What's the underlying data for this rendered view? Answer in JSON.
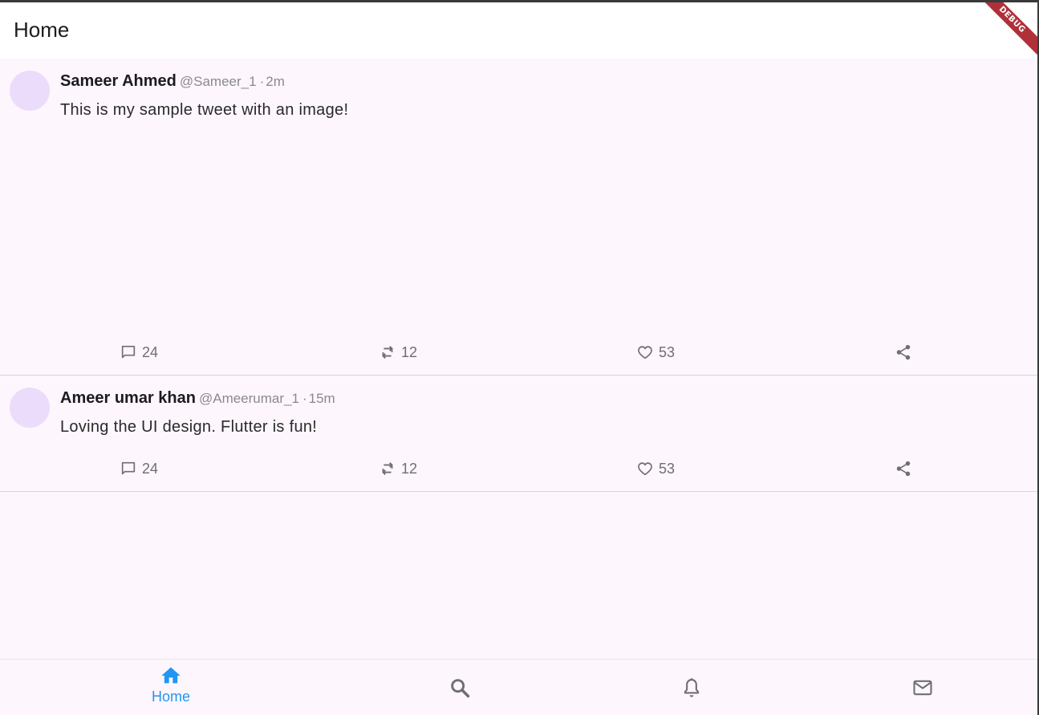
{
  "appbar": {
    "title": "Home",
    "debug_label": "DEBUG"
  },
  "tweets": [
    {
      "name": "Sameer Ahmed",
      "handle": "@Sameer_1",
      "separator": "·",
      "time": "2m",
      "text": "This is my sample tweet with an image!",
      "replies": "24",
      "retweets": "12",
      "likes": "53"
    },
    {
      "name": "Ameer umar khan",
      "handle": "@Ameerumar_1",
      "separator": "·",
      "time": "15m",
      "text": "Loving the UI design. Flutter is fun!",
      "replies": "24",
      "retweets": "12",
      "likes": "53"
    }
  ],
  "bottom_nav": {
    "items": [
      {
        "icon": "home-icon",
        "label": "Home",
        "active": true
      },
      {
        "icon": "search-icon"
      },
      {
        "icon": "bell-icon"
      },
      {
        "icon": "mail-icon"
      }
    ],
    "active_color": "#2196f3",
    "inactive_color": "#6f6f6f"
  }
}
